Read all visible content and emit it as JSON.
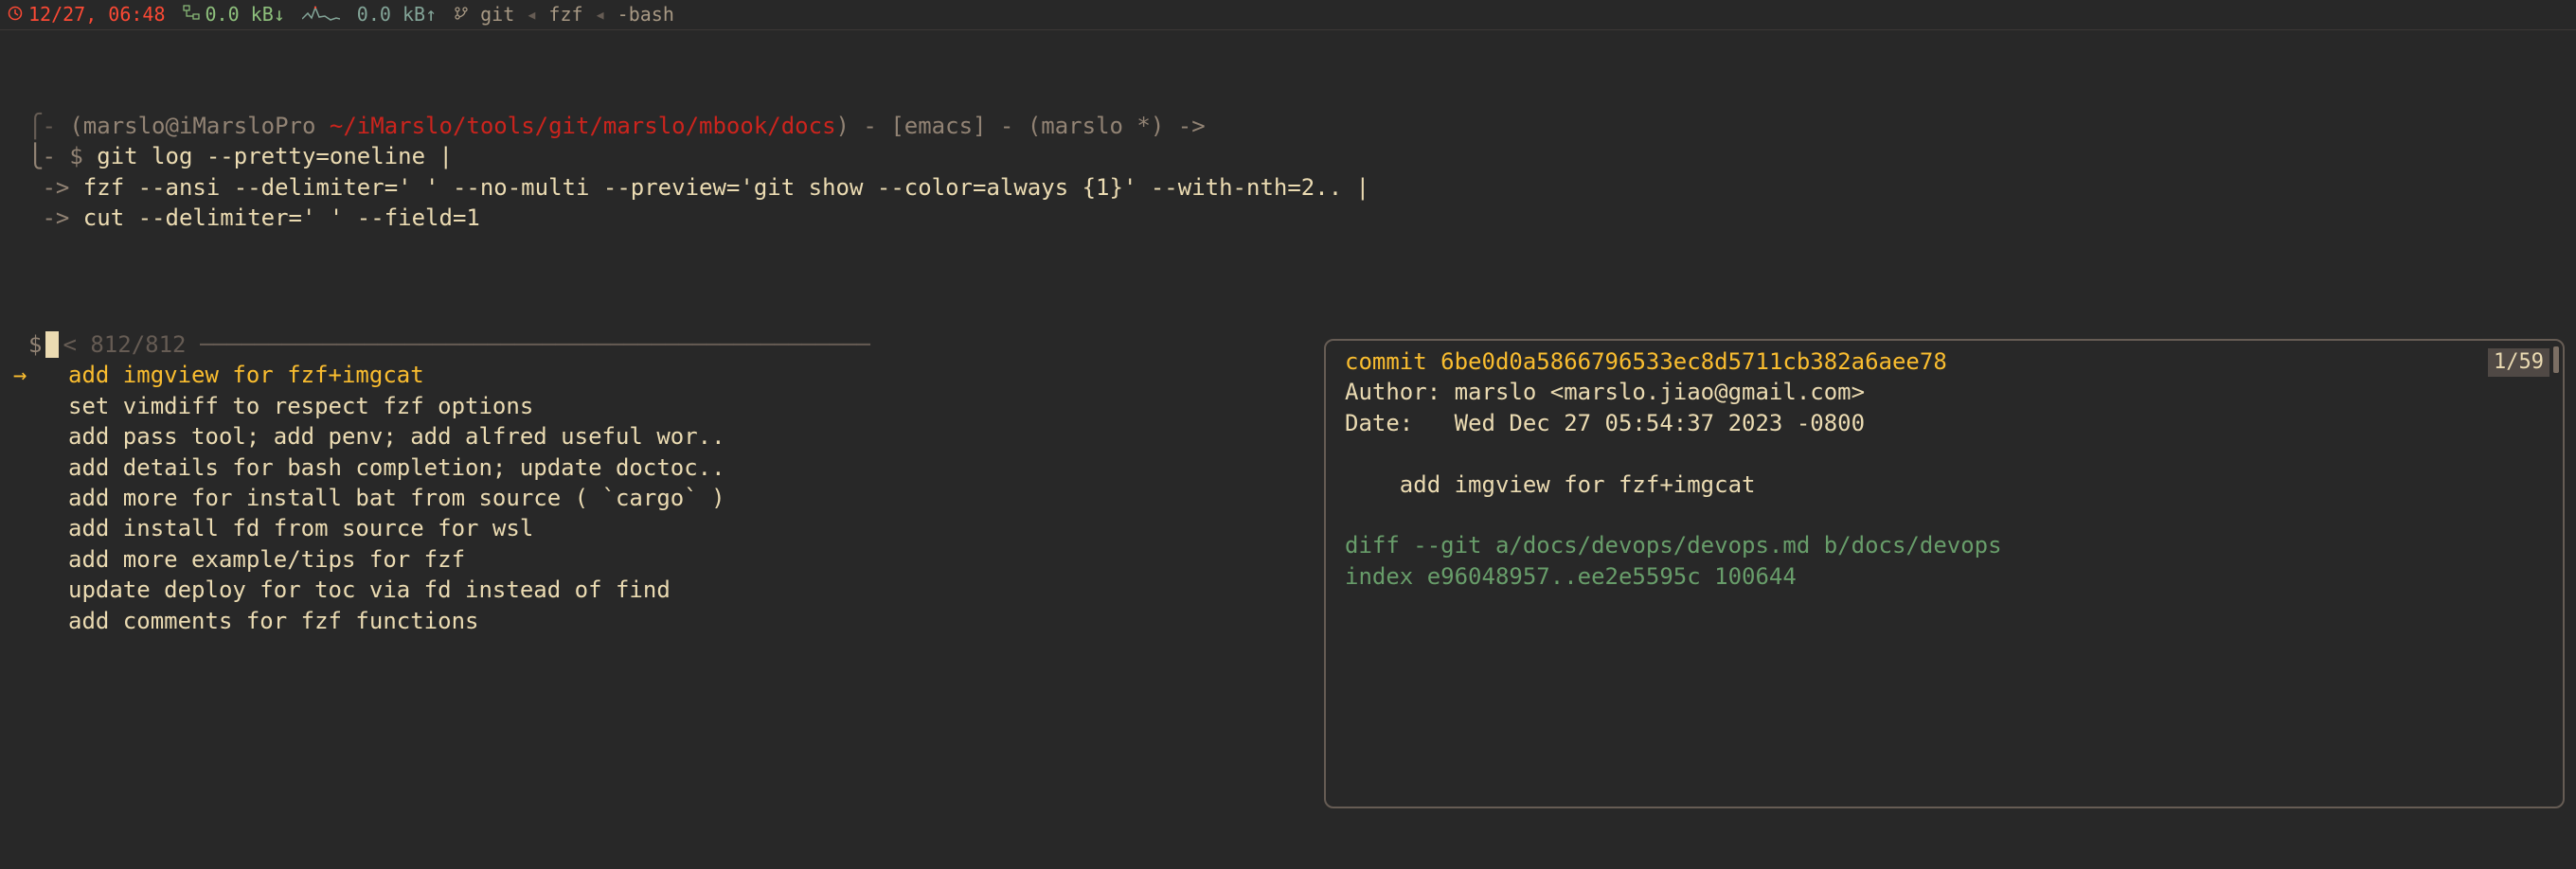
{
  "statusbar": {
    "clock_icon": "⏱",
    "datetime": "12/27, 06:48",
    "net_down": "0.0 kB↓",
    "net_up": "0.0 kB↑",
    "process_chain": {
      "icon": "⎇",
      "p1": "git",
      "sep": "◂",
      "p2": "fzf",
      "p3": "-bash"
    }
  },
  "prompt": {
    "corner_top": "⎧-",
    "user_host": "(marslo@iMarsloPro",
    "path": "~/iMarslo/tools/git/marslo/mbook/docs",
    "after_path": ")",
    "editor": " - [emacs] - ",
    "branch": "(marslo *) ->",
    "corner_bottom": "⎩- $",
    "arrow": "->"
  },
  "command": {
    "line1": " git log --pretty=oneline |",
    "line2": " fzf --ansi --delimiter=' ' --no-multi --preview='git show --color=always {1}' --with-nth=2.. |",
    "line3": " cut --delimiter=' ' --field=1"
  },
  "fzf": {
    "shell_prompt": "$",
    "input_marker": "<",
    "count": "812/812",
    "rule": "─────────────────────────────────────────────────",
    "pointer": "→",
    "items": [
      "add imgview for fzf+imgcat",
      "set vimdiff to respect fzf options",
      "add pass tool; add penv; add alfred useful wor..",
      "add details for bash completion; update doctoc..",
      "add more for install bat from source ( `cargo` )",
      "add install fd from source for wsl",
      "add more example/tips for fzf",
      "update deploy for toc via fd instead of find",
      "add comments for fzf functions"
    ],
    "selected_index": 0
  },
  "preview": {
    "commit_label": "commit",
    "commit_hash": "6be0d0a5866796533ec8d5711cb382a6aee78",
    "pager": "1/59",
    "author": "Author: marslo <marslo.jiao@gmail.com>",
    "date": "Date:   Wed Dec 27 05:54:37 2023 -0800",
    "blank": " ",
    "message": "    add imgview for fzf+imgcat",
    "blank2": " ",
    "diff1": "diff --git a/docs/devops/devops.md b/docs/devops",
    "diff2": "index e96048957..ee2e5595c 100644"
  }
}
